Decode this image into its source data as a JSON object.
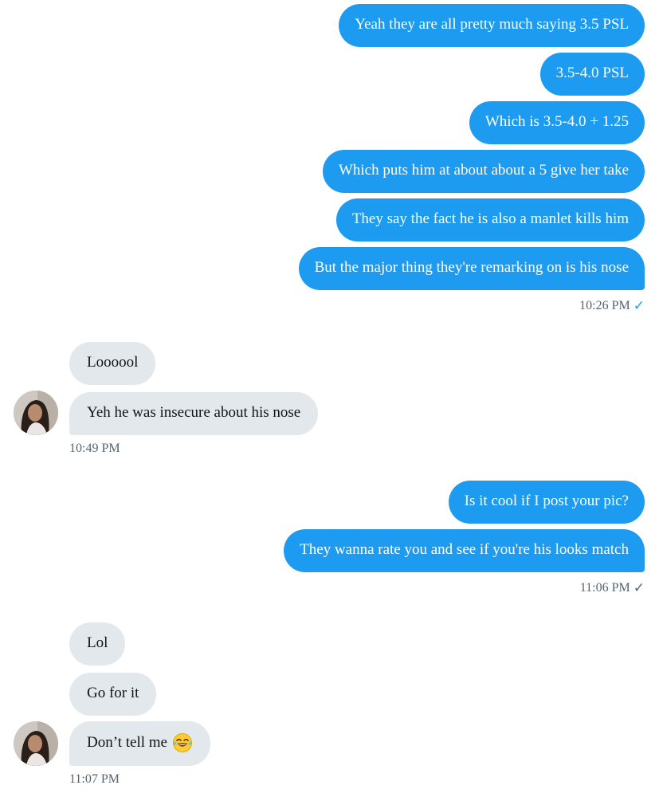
{
  "colors": {
    "sent_bubble": "#1d9bf0",
    "received_bubble": "#e3e8ec",
    "timestamp": "#536471",
    "read_check": "#1d9bf0"
  },
  "groups": [
    {
      "direction": "outgoing",
      "messages": [
        "Yeah they are all pretty much saying 3.5 PSL",
        "3.5-4.0 PSL",
        "Which is 3.5-4.0 + 1.25",
        "Which puts him at about about a 5 give her take",
        "They say the fact he is also a manlet kills him",
        "But the major thing they're remarking on is his nose"
      ],
      "time": "10:26 PM",
      "status_icon": "read-check-icon"
    },
    {
      "direction": "incoming",
      "messages": [
        "Loooool",
        "Yeh he was insecure about his nose"
      ],
      "time": "10:49 PM",
      "avatar_icon": "user-avatar"
    },
    {
      "direction": "outgoing",
      "messages": [
        "Is it cool if I post your pic?",
        "They wanna rate you and see if you're his looks match"
      ],
      "time": "11:06 PM",
      "status_icon": "sent-check-icon"
    },
    {
      "direction": "incoming",
      "messages": [
        "Lol",
        "Go for it",
        "Don’t tell me"
      ],
      "emoji": "tears-of-joy-emoji",
      "time": "11:07 PM",
      "avatar_icon": "user-avatar"
    }
  ]
}
